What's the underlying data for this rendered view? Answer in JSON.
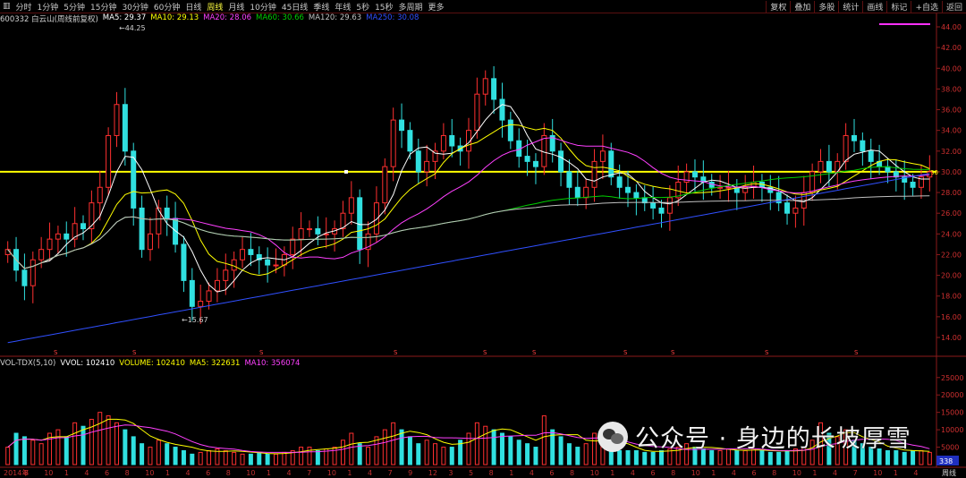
{
  "toolbar": {
    "periods": [
      "分时",
      "1分钟",
      "5分钟",
      "15分钟",
      "30分钟",
      "60分钟",
      "日线",
      "周线",
      "月线",
      "10分钟",
      "45日线",
      "季线",
      "年线",
      "5秒",
      "15秒",
      "多周期",
      "更多"
    ],
    "active_period": "周线",
    "right_buttons": [
      "复权",
      "叠加",
      "多股",
      "统计",
      "画线",
      "标记",
      "+自选",
      "返回"
    ]
  },
  "info": {
    "stock": "600332 白云山(周线前复权)",
    "ma5": "MA5: 29.37",
    "ma10": "MA10: 29.13",
    "ma20": "MA20: 28.06",
    "ma60": "MA60: 30.66",
    "ma120": "MA120: 29.63",
    "ma250": "MA250: 30.08"
  },
  "volume_info": {
    "name": "VOL-TDX(5,10)",
    "vvol": "VVOL: 102410",
    "volume": "VOLUME: 102410",
    "ma5": "MA5: 322631",
    "ma10": "MA10: 356074"
  },
  "price_axis": [
    "44.00",
    "42.00",
    "40.00",
    "38.00",
    "36.00",
    "34.00",
    "32.00",
    "30.00",
    "28.00",
    "26.00",
    "24.00",
    "22.00",
    "20.00",
    "18.00",
    "16.00",
    "14.00"
  ],
  "price_axis_current": "30",
  "volume_axis": [
    "25000",
    "20000",
    "15000",
    "10000",
    "5000"
  ],
  "volume_axis_badge": "338",
  "annotations": {
    "high": "44.25",
    "low": "15.67"
  },
  "date_axis": [
    "2014年",
    "8",
    "10",
    "1",
    "4",
    "6",
    "8",
    "10",
    "1",
    "4",
    "6",
    "8",
    "10",
    "1",
    "4",
    "7",
    "10",
    "1",
    "4",
    "7",
    "9",
    "12",
    "3",
    "5",
    "8",
    "1",
    "4",
    "6",
    "8",
    "10",
    "1",
    "4",
    "6",
    "8",
    "10",
    "1",
    "4",
    "6",
    "8",
    "10",
    "1",
    "4",
    "7",
    "10",
    "1",
    "4"
  ],
  "period_badge": "周线",
  "watermark": "公众号 · 身边的长坡厚雪",
  "colors": {
    "ma5": "#ffffff",
    "ma10": "#ffff00",
    "ma20": "#ff40ff",
    "ma60": "#00d000",
    "ma120": "#c0c0c0",
    "ma250": "#3050ff",
    "up": "#ff3030",
    "down": "#30e0e0",
    "line30": "#ffff00"
  },
  "chart_data": {
    "type": "line",
    "title": "",
    "ylim": [
      13,
      44.5
    ],
    "close": [
      22.5,
      20.5,
      19.0,
      21.5,
      22.5,
      23.5,
      24.0,
      23.5,
      25.0,
      24.5,
      27.0,
      28.5,
      33.5,
      36.5,
      32.0,
      26.5,
      22.5,
      24.0,
      26.5,
      25.5,
      23.0,
      19.5,
      17.0,
      17.5,
      18.5,
      19.5,
      20.5,
      21.5,
      22.5,
      22.0,
      21.5,
      21.0,
      21.0,
      22.0,
      23.5,
      24.5,
      24.5,
      24.0,
      24.0,
      24.5,
      26.0,
      27.5,
      22.5,
      24.0,
      27.0,
      30.5,
      35.0,
      34.0,
      32.0,
      30.0,
      31.0,
      32.0,
      33.5,
      32.5,
      32.0,
      34.0,
      37.5,
      39.0,
      37.0,
      35.0,
      33.0,
      31.5,
      31.0,
      30.5,
      33.5,
      32.0,
      30.0,
      28.5,
      27.5,
      28.5,
      31.0,
      32.0,
      29.5,
      28.5,
      28.0,
      27.5,
      27.0,
      26.5,
      26.0,
      27.5,
      29.0,
      30.0,
      29.5,
      29.0,
      28.5,
      28.5,
      28.5,
      28.0,
      28.5,
      29.0,
      28.5,
      28.0,
      27.0,
      26.0,
      26.5,
      28.0,
      30.0,
      31.0,
      30.0,
      31.0,
      33.5,
      33.0,
      32.0,
      31.0,
      30.5,
      30.0,
      29.5,
      29.0,
      28.5,
      29.5,
      30.0
    ],
    "volume": [
      5000,
      9000,
      8000,
      7000,
      6000,
      9000,
      10000,
      8000,
      12000,
      11000,
      13000,
      15000,
      14000,
      12000,
      10000,
      8000,
      6000,
      5000,
      7000,
      6000,
      5000,
      4000,
      3000,
      3500,
      4000,
      4500,
      4000,
      3500,
      3000,
      3000,
      3500,
      3000,
      3000,
      3500,
      4000,
      5000,
      5000,
      4000,
      4500,
      5000,
      7000,
      9000,
      6000,
      5000,
      8000,
      10000,
      12000,
      10000,
      8000,
      6000,
      7000,
      6000,
      5000,
      5000,
      7000,
      9000,
      12000,
      11000,
      10000,
      9000,
      8000,
      7000,
      6000,
      5000,
      14000,
      10000,
      8000,
      6000,
      5000,
      6000,
      9000,
      8000,
      5000,
      4000,
      4000,
      4000,
      3500,
      3500,
      4000,
      4500,
      5000,
      6000,
      5000,
      4500,
      4000,
      4000,
      4500,
      4000,
      4000,
      4500,
      4000,
      3500,
      3500,
      4000,
      4500,
      5000,
      7000,
      12000,
      9000,
      8000,
      10000,
      7000,
      6000,
      5000,
      4500,
      4000,
      4000,
      3500,
      4000,
      4000,
      3500
    ]
  }
}
